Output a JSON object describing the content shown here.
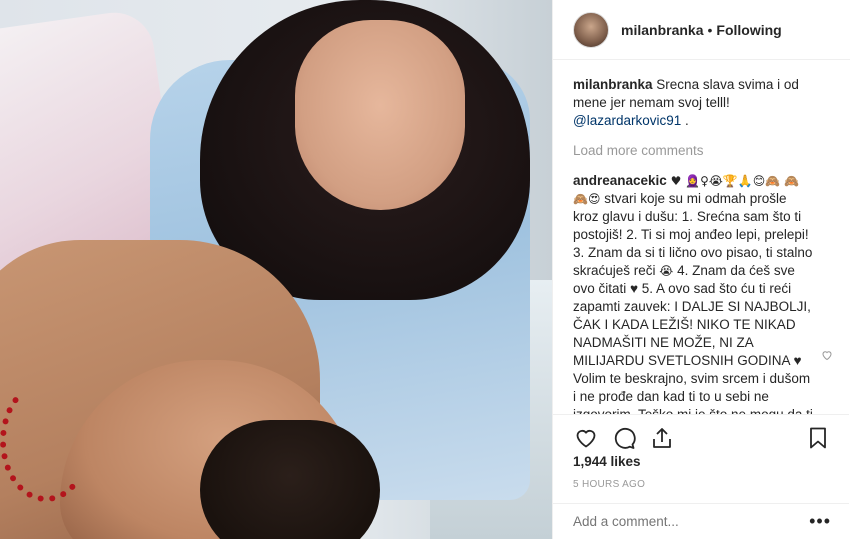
{
  "header": {
    "username": "milanbranka",
    "separator": "•",
    "follow_status": "Following"
  },
  "caption": {
    "user": "milanbranka",
    "text": "Srecna slava svima i od mene jer nemam svoj telll!",
    "mention": "@lazardarkovic91",
    "suffix": " ."
  },
  "load_more": "Load more comments",
  "comment": {
    "user": "andreanacekic",
    "emojis": "♥ 🧕♀😭🏆🙏😊🙈 🙈🙈😍",
    "text_1": "stvari koje su mi odmah prošle kroz glavu i dušu: 1. Srećna sam što ti postojiš! 2. Ti si moj anđeo lepi, prelepi! 3. Znam da si ti lično ovo pisao, ti stalno skraćuješ reči",
    "emoji_mid": "😭",
    "text_2": "4. Znam da ćeš sve ovo čitati ♥ 5. A ovo sad što ću ti reći zapamti zauvek: I DALJE SI NAJBOLJI, ČAK I KADA LEŽIŠ! NIKO TE NIKAD NADMAŠITI NE MOŽE, NI ZA MILIJARDU SVETLOSNIH GODINA ♥ Volim te beskrajno, svim srcem i dušom i ne prođe dan kad ti to u sebi ne izgovorim. Teško mi je što ne mogu da ti to i kažem, mada znam da znaš, ali najradije bih se preselila tu, da budem"
  },
  "likes": "1,944 likes",
  "timestamp": "5 HOURS AGO",
  "add_comment": {
    "placeholder": "Add a comment..."
  },
  "more_icon": "•••",
  "icons": [
    "heart-icon",
    "comment-icon",
    "share-icon",
    "bookmark-icon",
    "like-comment-icon"
  ]
}
